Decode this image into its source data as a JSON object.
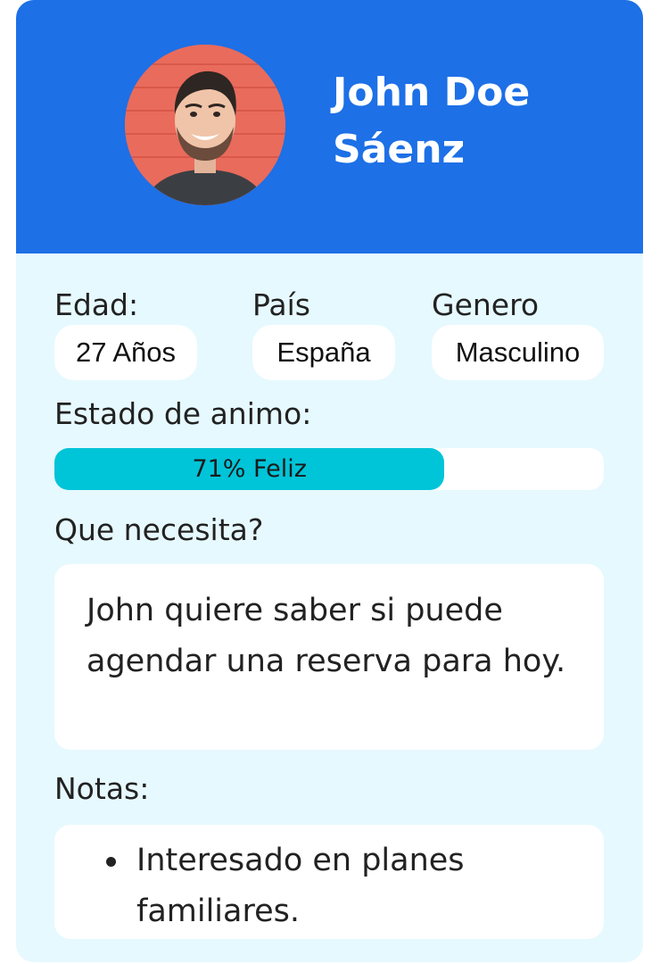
{
  "profile": {
    "name": "John Doe Sáenz"
  },
  "fields": {
    "age_label": "Edad:",
    "age_value": "27 Años",
    "country_label": "País",
    "country_value": "España",
    "gender_label": "Genero",
    "gender_value": "Masculino"
  },
  "mood": {
    "label": "Estado de animo:",
    "text": "71% Feliz",
    "percent": 71
  },
  "need": {
    "label": "Que necesita?",
    "text": "John quiere saber si puede agendar una reserva para hoy."
  },
  "notes": {
    "label": "Notas:",
    "items": [
      "Interesado en planes familiares."
    ]
  },
  "colors": {
    "header": "#1d70e6",
    "card_background": "#e6f9fe",
    "mood_fill": "#00c4d8",
    "avatar_background": "#e96b5c"
  }
}
